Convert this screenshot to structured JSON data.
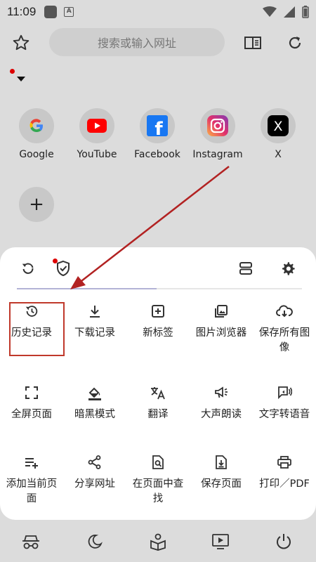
{
  "status_bar": {
    "time": "11:09",
    "a_badge": "A"
  },
  "toolbar": {
    "search_placeholder": "搜索或输入网址",
    "icons": [
      "star-icon",
      "reader-mode-icon",
      "reload-icon"
    ]
  },
  "speed_dial": [
    {
      "label": "Google",
      "letter": "G",
      "color": "#4285F4"
    },
    {
      "label": "YouTube",
      "color": "#FF0000"
    },
    {
      "label": "Facebook",
      "letter": "f",
      "color": "#1877F2"
    },
    {
      "label": "Instagram",
      "color": "#DD2A7B"
    },
    {
      "label": "X",
      "letter": "X",
      "color": "#000000"
    }
  ],
  "add_label": "+",
  "sheet": {
    "progress_fraction": 0.49,
    "menu": [
      {
        "label": "历史记录",
        "icon": "history-icon"
      },
      {
        "label": "下载记录",
        "icon": "download-icon"
      },
      {
        "label": "新标签",
        "icon": "new-tab-icon"
      },
      {
        "label": "图片浏览器",
        "icon": "image-viewer-icon"
      },
      {
        "label": "保存所有图像",
        "icon": "cloud-download-icon"
      },
      {
        "label": "全屏页面",
        "icon": "fullscreen-icon"
      },
      {
        "label": "暗黑模式",
        "icon": "dark-mode-icon"
      },
      {
        "label": "翻译",
        "icon": "translate-icon"
      },
      {
        "label": "大声朗读",
        "icon": "read-aloud-icon"
      },
      {
        "label": "文字转语音",
        "icon": "text-to-speech-icon"
      },
      {
        "label": "添加当前页面",
        "icon": "add-page-icon"
      },
      {
        "label": "分享网址",
        "icon": "share-icon"
      },
      {
        "label": "在页面中查找",
        "icon": "find-in-page-icon"
      },
      {
        "label": "保存页面",
        "icon": "save-page-icon"
      },
      {
        "label": "打印／PDF",
        "icon": "print-icon"
      }
    ]
  },
  "colors": {
    "accent_red": "#C0392B",
    "annotation_arrow": "#B22222"
  }
}
